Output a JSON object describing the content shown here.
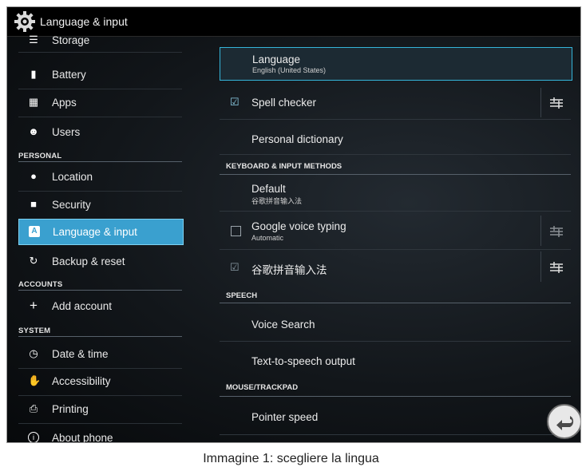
{
  "titlebar": {
    "title": "Language & input",
    "icon": "gear-icon"
  },
  "sidebar": {
    "items": [
      {
        "label": "Storage",
        "icon": "storage-icon"
      },
      {
        "label": "Battery",
        "icon": "battery-icon"
      },
      {
        "label": "Apps",
        "icon": "apps-icon"
      },
      {
        "label": "Users",
        "icon": "users-icon"
      },
      {
        "label": "Location",
        "icon": "location-icon"
      },
      {
        "label": "Security",
        "icon": "lock-icon"
      },
      {
        "label": "Language & input",
        "icon": "keyboard-icon",
        "selected": true
      },
      {
        "label": "Backup & reset",
        "icon": "backup-icon"
      },
      {
        "label": "Add account",
        "icon": "plus-icon"
      },
      {
        "label": "Date & time",
        "icon": "clock-icon"
      },
      {
        "label": "Accessibility",
        "icon": "hand-icon"
      },
      {
        "label": "Printing",
        "icon": "printer-icon"
      },
      {
        "label": "About phone",
        "icon": "info-icon"
      }
    ],
    "sections": {
      "personal": "PERSONAL",
      "accounts": "ACCOUNTS",
      "system": "SYSTEM"
    }
  },
  "main": {
    "language": {
      "title": "Language",
      "subtitle": "English (United States)"
    },
    "spell_checker": {
      "title": "Spell checker",
      "checked": true
    },
    "personal_dictionary": {
      "title": "Personal dictionary"
    },
    "section_keyboard": "KEYBOARD & INPUT METHODS",
    "default": {
      "title": "Default",
      "subtitle": "谷歌拼音输入法"
    },
    "google_voice": {
      "title": "Google voice typing",
      "subtitle": "Automatic",
      "checked": false
    },
    "pinyin": {
      "title": "谷歌拼音输入法",
      "checked": true
    },
    "section_speech": "SPEECH",
    "voice_search": {
      "title": "Voice Search"
    },
    "tts": {
      "title": "Text-to-speech output"
    },
    "section_mouse": "MOUSE/TRACKPAD",
    "pointer_speed": {
      "title": "Pointer speed"
    }
  },
  "caption": "Immagine 1: scegliere la lingua",
  "colors": {
    "accent": "#3aa0cf",
    "selected_border": "#35b5da",
    "background": "#0b0d10"
  }
}
